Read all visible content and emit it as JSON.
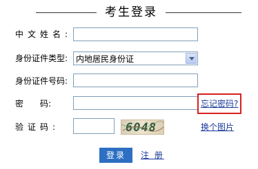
{
  "header": {
    "title": "考生登录"
  },
  "form": {
    "name_label": "中文姓名:",
    "id_type_label": "身份证件类型:",
    "id_type_selected": "内地居民身份证",
    "id_number_label": "身份证件号码:",
    "password_label": "密　　码:",
    "captcha_label": "验证码:",
    "captcha_text": "6048",
    "forgot_password": "忘记密码?",
    "change_image": "换个图片"
  },
  "actions": {
    "login": "登录",
    "register": "注 册"
  },
  "colors": {
    "highlight": "#d81e1e",
    "link": "#1a3a9a",
    "button": "#2d6fc2"
  }
}
